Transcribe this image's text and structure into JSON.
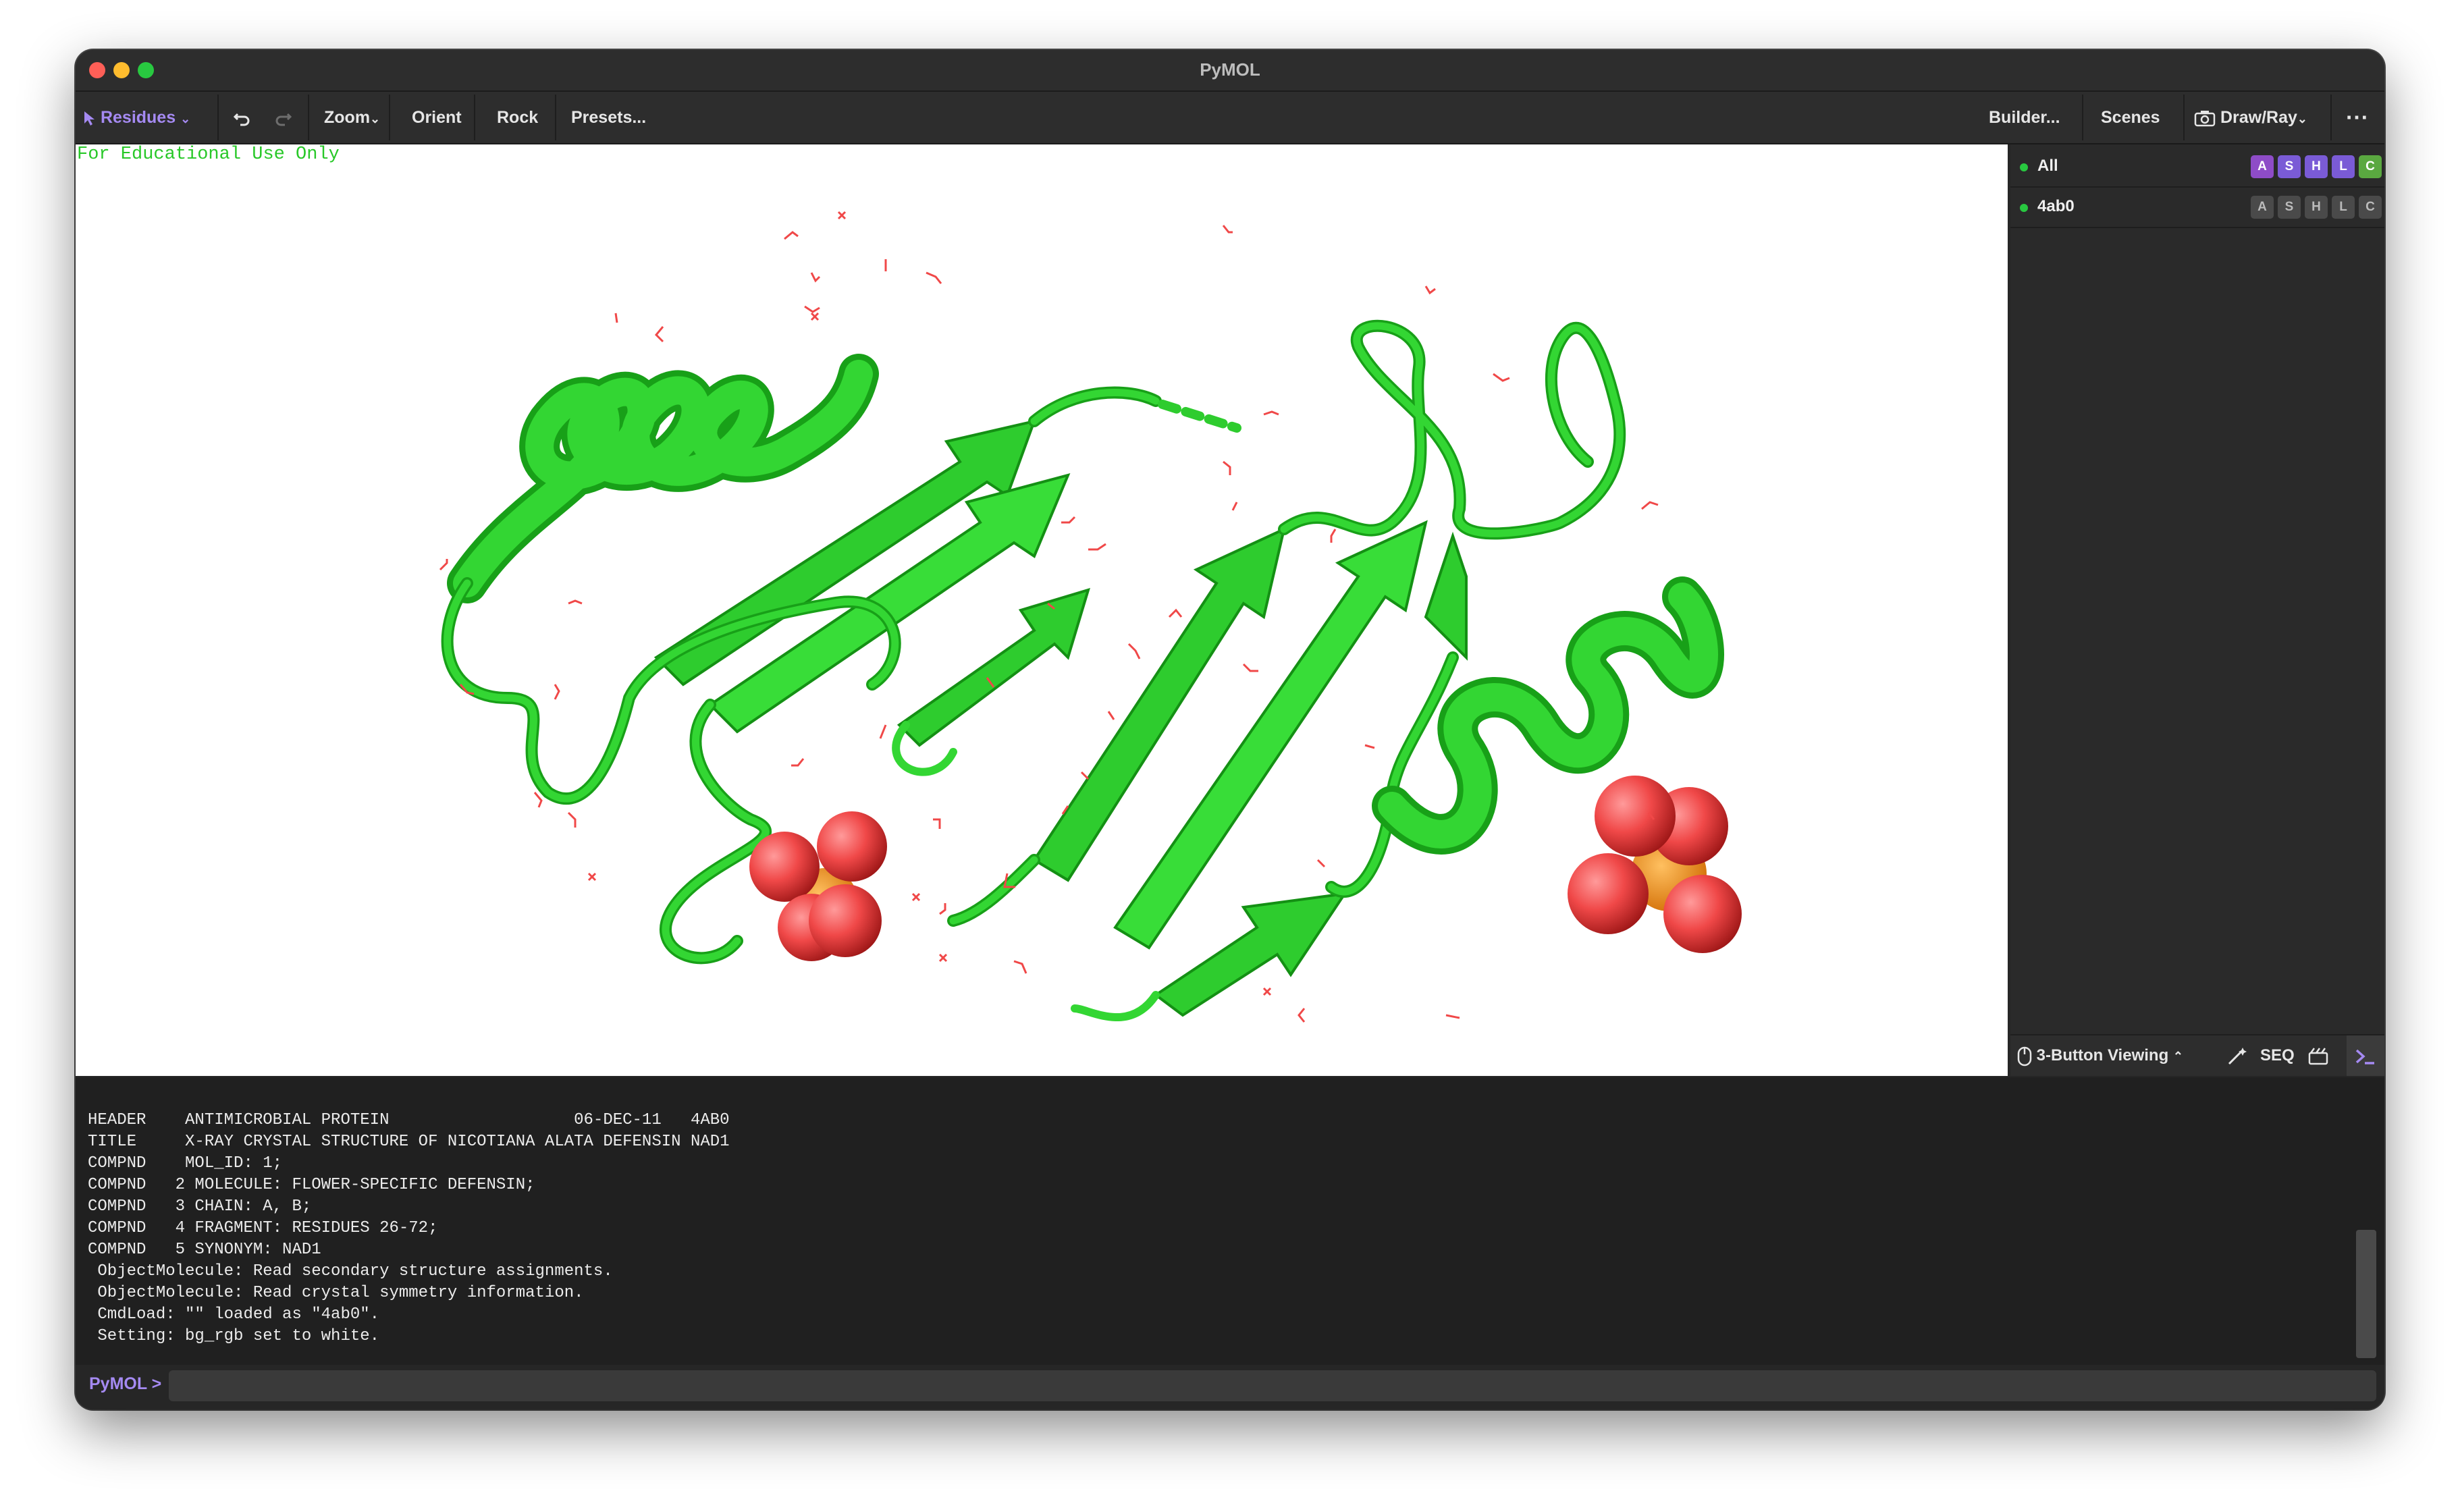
{
  "window": {
    "title": "PyMOL"
  },
  "toolbar": {
    "residues_label": "Residues",
    "undo_icon": "undo-icon",
    "redo_icon": "redo-icon",
    "zoom_label": "Zoom",
    "orient_label": "Orient",
    "rock_label": "Rock",
    "presets_label": "Presets...",
    "builder_label": "Builder...",
    "scenes_label": "Scenes",
    "drawray_label": "Draw/Ray",
    "more_icon": "more-icon"
  },
  "viewport": {
    "watermark": "For Educational Use Only",
    "colors": {
      "cartoon": "#22cc22",
      "oxygen": "#f03c3c",
      "phosphorus": "#f08a1a"
    }
  },
  "objects": [
    {
      "name": "All",
      "buttons": [
        "A",
        "S",
        "H",
        "L",
        "C"
      ]
    },
    {
      "name": "4ab0",
      "buttons": [
        "A",
        "S",
        "H",
        "L",
        "C"
      ]
    }
  ],
  "panel_bottom": {
    "viewing_label": "3-Button Viewing",
    "seq_label": "SEQ"
  },
  "console": {
    "lines": [
      "HEADER    ANTIMICROBIAL PROTEIN                   06-DEC-11   4AB0",
      "TITLE     X-RAY CRYSTAL STRUCTURE OF NICOTIANA ALATA DEFENSIN NAD1",
      "COMPND    MOL_ID: 1;",
      "COMPND   2 MOLECULE: FLOWER-SPECIFIC DEFENSIN;",
      "COMPND   3 CHAIN: A, B;",
      "COMPND   4 FRAGMENT: RESIDUES 26-72;",
      "COMPND   5 SYNONYM: NAD1",
      " ObjectMolecule: Read secondary structure assignments.",
      " ObjectMolecule: Read crystal symmetry information.",
      " CmdLoad: \"\" loaded as \"4ab0\".",
      " Setting: bg_rgb set to white."
    ],
    "prompt": "PyMOL >",
    "input_value": ""
  }
}
